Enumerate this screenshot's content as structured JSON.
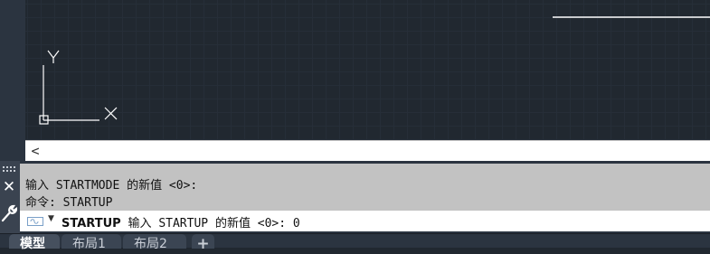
{
  "scrollbar": {
    "left_arrow": "<"
  },
  "command_window": {
    "close_glyph": "✕",
    "history": [
      "输入 STARTMODE 的新值 <0>:",
      "命令: STARTUP"
    ],
    "prompt": {
      "command": "STARTUP",
      "text": " 输入 STARTUP 的新值 <0>: 0"
    }
  },
  "layout_tabs": [
    {
      "label": "模型",
      "active": true
    },
    {
      "label": "布局1",
      "active": false
    },
    {
      "label": "布局2",
      "active": false
    }
  ],
  "add_tab_glyph": "+",
  "ucs": {
    "x_label": "X",
    "y_label": "Y"
  },
  "colors": {
    "canvas": "#212830",
    "history_bg": "#c2c2c2",
    "ucs": "#ffffff"
  }
}
